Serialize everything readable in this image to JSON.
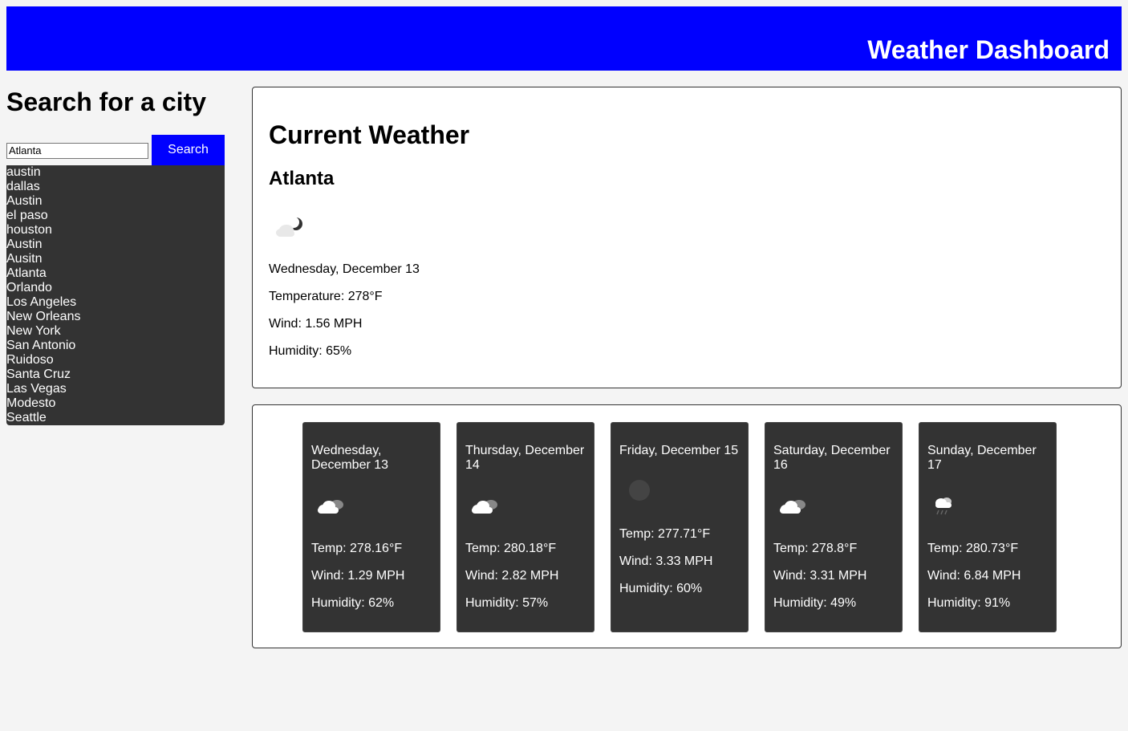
{
  "header": {
    "title": "Weather Dashboard",
    "background_color": "#0000ff"
  },
  "search": {
    "heading": "Search for a city",
    "input_value": "Atlanta",
    "button_label": "Search",
    "history": [
      "austin",
      "dallas",
      "Austin",
      "el paso",
      "houston",
      "Austin",
      "Ausitn",
      "Atlanta",
      "Orlando",
      "Los Angeles",
      "New Orleans",
      "New York",
      "San Antonio",
      "Ruidoso",
      "Santa Cruz",
      "Las Vegas",
      "Modesto",
      "Seattle"
    ]
  },
  "current": {
    "heading": "Current Weather",
    "city": "Atlanta",
    "icon": "night-cloud-icon",
    "date": "Wednesday, December 13",
    "temperature": "Temperature: 278°F",
    "wind": "Wind: 1.56 MPH",
    "humidity": "Humidity: 65%"
  },
  "forecast": [
    {
      "date": "Wednesday, December 13",
      "icon": "broken-clouds-icon",
      "temp": "Temp: 278.16°F",
      "wind": "Wind: 1.29 MPH",
      "humidity": "Humidity: 62%"
    },
    {
      "date": "Thursday, December 14",
      "icon": "broken-clouds-icon",
      "temp": "Temp: 280.18°F",
      "wind": "Wind: 2.82 MPH",
      "humidity": "Humidity: 57%"
    },
    {
      "date": "Friday, December 15",
      "icon": "clear-night-icon",
      "temp": "Temp: 277.71°F",
      "wind": "Wind: 3.33 MPH",
      "humidity": "Humidity: 60%"
    },
    {
      "date": "Saturday, December 16",
      "icon": "broken-clouds-icon",
      "temp": "Temp: 278.8°F",
      "wind": "Wind: 3.31 MPH",
      "humidity": "Humidity: 49%"
    },
    {
      "date": "Sunday, December 17",
      "icon": "rain-cloud-icon",
      "temp": "Temp: 280.73°F",
      "wind": "Wind: 6.84 MPH",
      "humidity": "Humidity: 91%"
    }
  ]
}
